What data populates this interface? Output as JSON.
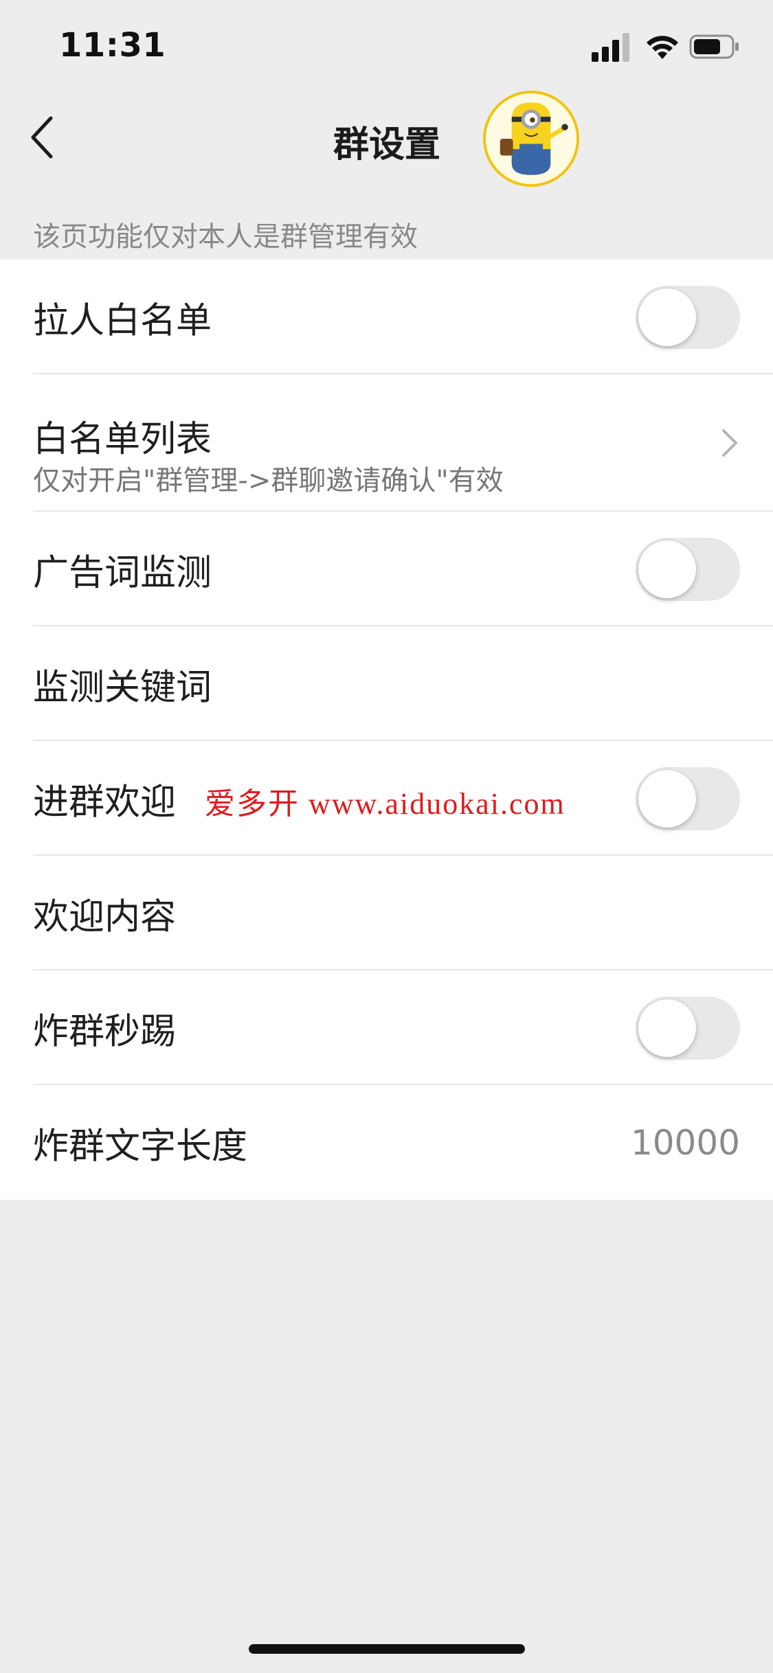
{
  "status_bar": {
    "time": "11:31",
    "signal_icon": "cellular-signal-icon",
    "wifi_icon": "wifi-icon",
    "battery_icon": "battery-icon"
  },
  "nav": {
    "back_icon": "chevron-left-icon",
    "title": "群设置",
    "avatar": "minion-avatar"
  },
  "hint": "该页功能仅对本人是群管理有效",
  "settings": {
    "whitelist_toggle": {
      "label": "拉人白名单",
      "on": false
    },
    "whitelist_list": {
      "label": "白名单列表",
      "sublabel": "仅对开启\"群管理->群聊邀请确认\"有效",
      "chevron_icon": "chevron-right-icon"
    },
    "ad_monitor": {
      "label": "广告词监测",
      "on": false
    },
    "monitor_keywords": {
      "label": "监测关键词"
    },
    "welcome": {
      "label": "进群欢迎",
      "on": false
    },
    "welcome_content": {
      "label": "欢迎内容"
    },
    "bomb_kick": {
      "label": "炸群秒踢",
      "on": false
    },
    "bomb_length": {
      "label": "炸群文字长度",
      "value": "10000"
    }
  },
  "watermark": "爱多开 www.aiduokai.com",
  "colors": {
    "background": "#ededed",
    "card": "#ffffff",
    "toggle_off": "#e8e8e8",
    "watermark": "#e01b1b"
  }
}
